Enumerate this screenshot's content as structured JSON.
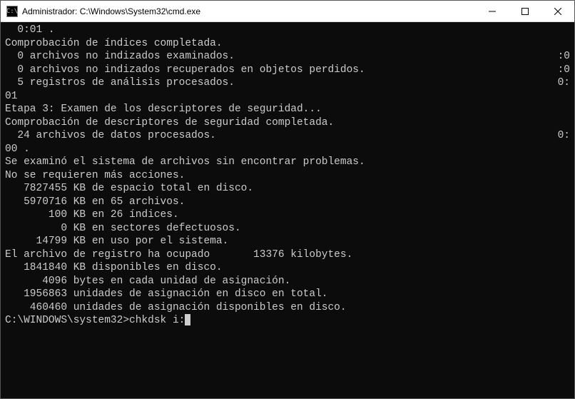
{
  "window": {
    "title": "Administrador: C:\\Windows\\System32\\cmd.exe",
    "icon_glyph": "C:\\"
  },
  "controls": {
    "minimize_label": "Minimize",
    "maximize_label": "Maximize",
    "close_label": "Close"
  },
  "lines": [
    {
      "left": "  0:01 .",
      "right": ""
    },
    {
      "left": "Comprobación de índices completada.",
      "right": ""
    },
    {
      "left": "  0 archivos no indizados examinados.",
      "right": ":0"
    },
    {
      "left": "  0 archivos no indizados recuperados en objetos perdidos.",
      "right": ":0"
    },
    {
      "left": "  5 registros de análisis procesados.",
      "right": "0:"
    },
    {
      "left": "01",
      "right": ""
    },
    {
      "left": "Etapa 3: Examen de los descriptores de seguridad...",
      "right": ""
    },
    {
      "left": "Comprobación de descriptores de seguridad completada.",
      "right": ""
    },
    {
      "left": "  24 archivos de datos procesados.",
      "right": "0:"
    },
    {
      "left": "00 .",
      "right": ""
    },
    {
      "left": "Se examinó el sistema de archivos sin encontrar problemas.",
      "right": ""
    },
    {
      "left": "No se requieren más acciones.",
      "right": ""
    },
    {
      "left": "",
      "right": ""
    },
    {
      "left": "   7827455 KB de espacio total en disco.",
      "right": ""
    },
    {
      "left": "   5970716 KB en 65 archivos.",
      "right": ""
    },
    {
      "left": "       100 KB en 26 índices.",
      "right": ""
    },
    {
      "left": "         0 KB en sectores defectuosos.",
      "right": ""
    },
    {
      "left": "     14799 KB en uso por el sistema.",
      "right": ""
    },
    {
      "left": "El archivo de registro ha ocupado       13376 kilobytes.",
      "right": ""
    },
    {
      "left": "   1841840 KB disponibles en disco.",
      "right": ""
    },
    {
      "left": "",
      "right": ""
    },
    {
      "left": "      4096 bytes en cada unidad de asignación.",
      "right": ""
    },
    {
      "left": "   1956863 unidades de asignación en disco en total.",
      "right": ""
    },
    {
      "left": "    460460 unidades de asignación disponibles en disco.",
      "right": ""
    },
    {
      "left": "",
      "right": ""
    }
  ],
  "prompt": {
    "path": "C:\\WINDOWS\\system32>",
    "command": "chkdsk i:"
  }
}
